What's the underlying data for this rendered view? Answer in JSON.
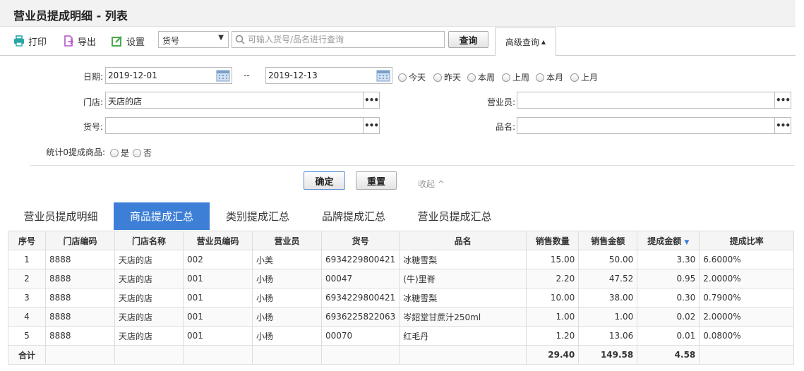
{
  "page": {
    "title": "营业员提成明细 - 列表"
  },
  "toolbar": {
    "print": "打印",
    "export": "导出",
    "settings": "设置",
    "field_select": "货号",
    "search_placeholder": "可输入货号/品名进行查询",
    "query": "查询",
    "advanced": "高级查询"
  },
  "filter": {
    "date_label": "日期:",
    "date_from": "2019-12-01",
    "date_sep": "--",
    "date_to": "2019-12-13",
    "quick_dates": [
      "今天",
      "昨天",
      "本周",
      "上周",
      "本月",
      "上月"
    ],
    "store_label": "门店:",
    "store_value": "天店的店",
    "clerk_label": "营业员:",
    "clerk_value": "",
    "sku_label": "货号:",
    "sku_value": "",
    "name_label": "品名:",
    "name_value": "",
    "zero_label": "统计0提成商品:",
    "zero_yes": "是",
    "zero_no": "否",
    "confirm": "确定",
    "reset": "重置",
    "collapse": "收起"
  },
  "tabs": [
    "营业员提成明细",
    "商品提成汇总",
    "类别提成汇总",
    "品牌提成汇总",
    "营业员提成汇总"
  ],
  "active_tab": 1,
  "table": {
    "headers": [
      "序号",
      "门店编码",
      "门店名称",
      "营业员编码",
      "营业员",
      "货号",
      "品名",
      "销售数量",
      "销售金额",
      "提成金额",
      "提成比率"
    ],
    "rows": [
      [
        "1",
        "8888",
        "天店的店",
        "002",
        "小美",
        "6934229800421",
        "冰糖雪梨",
        "15.00",
        "50.00",
        "3.30",
        "6.6000%"
      ],
      [
        "2",
        "8888",
        "天店的店",
        "001",
        "小杨",
        "00047",
        "(牛)里脊",
        "2.20",
        "47.52",
        "0.95",
        "2.0000%"
      ],
      [
        "3",
        "8888",
        "天店的店",
        "001",
        "小杨",
        "6934229800421",
        "冰糖雪梨",
        "10.00",
        "38.00",
        "0.30",
        "0.7900%"
      ],
      [
        "4",
        "8888",
        "天店的店",
        "001",
        "小杨",
        "6936225822063",
        "岑鉊堂甘蔗汁250ml",
        "1.00",
        "1.00",
        "0.02",
        "2.0000%"
      ],
      [
        "5",
        "8888",
        "天店的店",
        "001",
        "小杨",
        "00070",
        "红毛丹",
        "1.20",
        "13.06",
        "0.01",
        "0.0800%"
      ]
    ],
    "total_label": "合计",
    "total_qty": "29.40",
    "total_amount": "149.58",
    "total_commission": "4.58"
  },
  "colors": {
    "accent": "#3d7fd6",
    "icon_teal": "#2aa6a6",
    "icon_purple": "#b455c9",
    "icon_green": "#3aa23a"
  }
}
